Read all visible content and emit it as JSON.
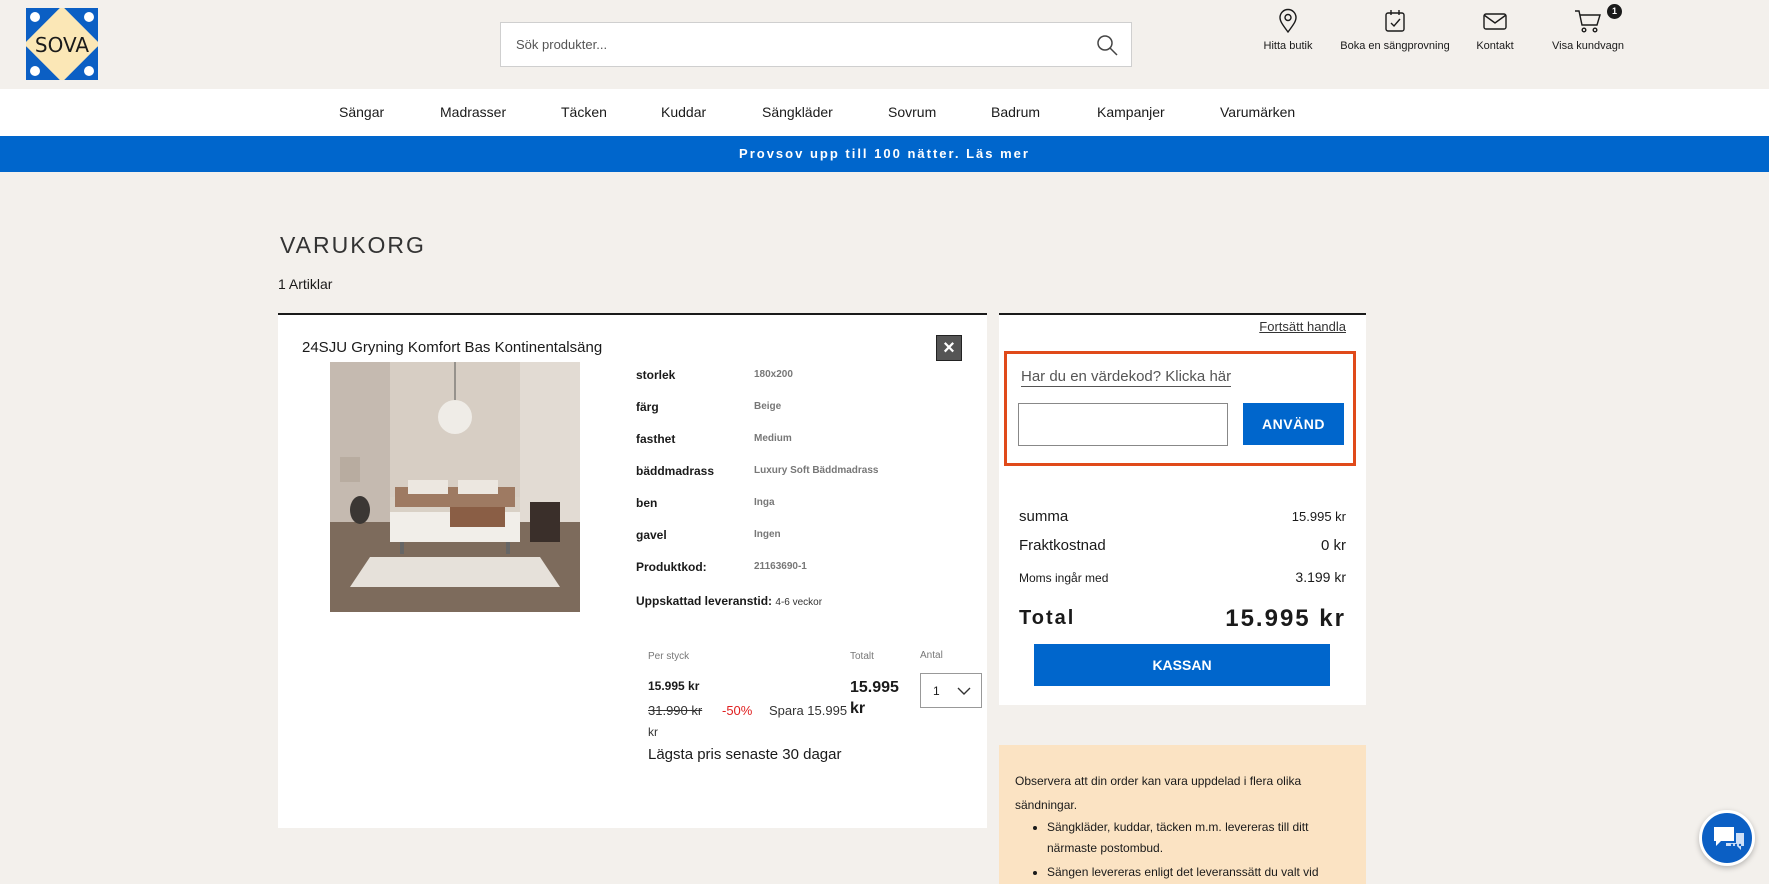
{
  "header": {
    "logo_text": "SOVA",
    "search_placeholder": "Sök produkter...",
    "icons": [
      {
        "label": "Hitta butik",
        "icon": "location-pin-icon"
      },
      {
        "label": "Boka en sängprovning",
        "icon": "calendar-check-icon"
      },
      {
        "label": "Kontakt",
        "icon": "mail-icon"
      },
      {
        "label": "Visa kundvagn",
        "icon": "cart-icon",
        "badge": "1"
      }
    ]
  },
  "nav": [
    "Sängar",
    "Madrasser",
    "Täcken",
    "Kuddar",
    "Sängkläder",
    "Sovrum",
    "Badrum",
    "Kampanjer",
    "Varumärken"
  ],
  "promo": "Provsov upp till 100 nätter. Läs mer",
  "cart": {
    "title": "VARUKORG",
    "count": "1 Artiklar",
    "item": {
      "name": "24SJU Gryning Komfort Bas Kontinentalsäng",
      "specs": [
        {
          "k": "storlek",
          "v": "180x200"
        },
        {
          "k": "färg",
          "v": "Beige"
        },
        {
          "k": "fasthet",
          "v": "Medium"
        },
        {
          "k": "bäddmadrass",
          "v": "Luxury Soft Bäddmadrass"
        },
        {
          "k": "ben",
          "v": "Inga"
        },
        {
          "k": "gavel",
          "v": "Ingen"
        },
        {
          "k": "Produktkod:",
          "v": "21163690-1"
        }
      ],
      "lead_label": "Uppskattad leveranstid:",
      "lead_value": "4-6 veckor",
      "per_label": "Per styck",
      "total_label": "Totalt",
      "qty_label": "Antal",
      "unit_price": "15.995 kr",
      "old_price": "31.990 kr",
      "discount": "-50%",
      "save": "Spara 15.995",
      "kr": "kr",
      "lowest": "Lägsta pris senaste 30 dagar",
      "total_price": "15.995 kr",
      "qty": "1"
    }
  },
  "summary": {
    "continue": "Fortsätt handla",
    "voucher_link": "Har du en värdekod? Klicka här",
    "apply": "ANVÄND",
    "sum_label": "summa",
    "sum_value": "15.995 kr",
    "freight_label": "Fraktkostnad",
    "freight_value": "0 kr",
    "vat_label": "Moms ingår med",
    "vat_value": "3.199 kr",
    "total_label": "Total",
    "total_value": "15.995 kr",
    "checkout": "KASSAN"
  },
  "notice": {
    "intro": "Observera att din order kan vara uppdelad i flera olika sändningar.",
    "items": [
      "Sängkläder, kuddar, täcken m.m. levereras till ditt närmaste postombud.",
      "Sängen levereras enligt det leveranssätt du valt vid"
    ]
  },
  "colors": {
    "brand_blue": "#0066cc",
    "voucher_border": "#e04a1a",
    "discount_red": "#e02020"
  }
}
